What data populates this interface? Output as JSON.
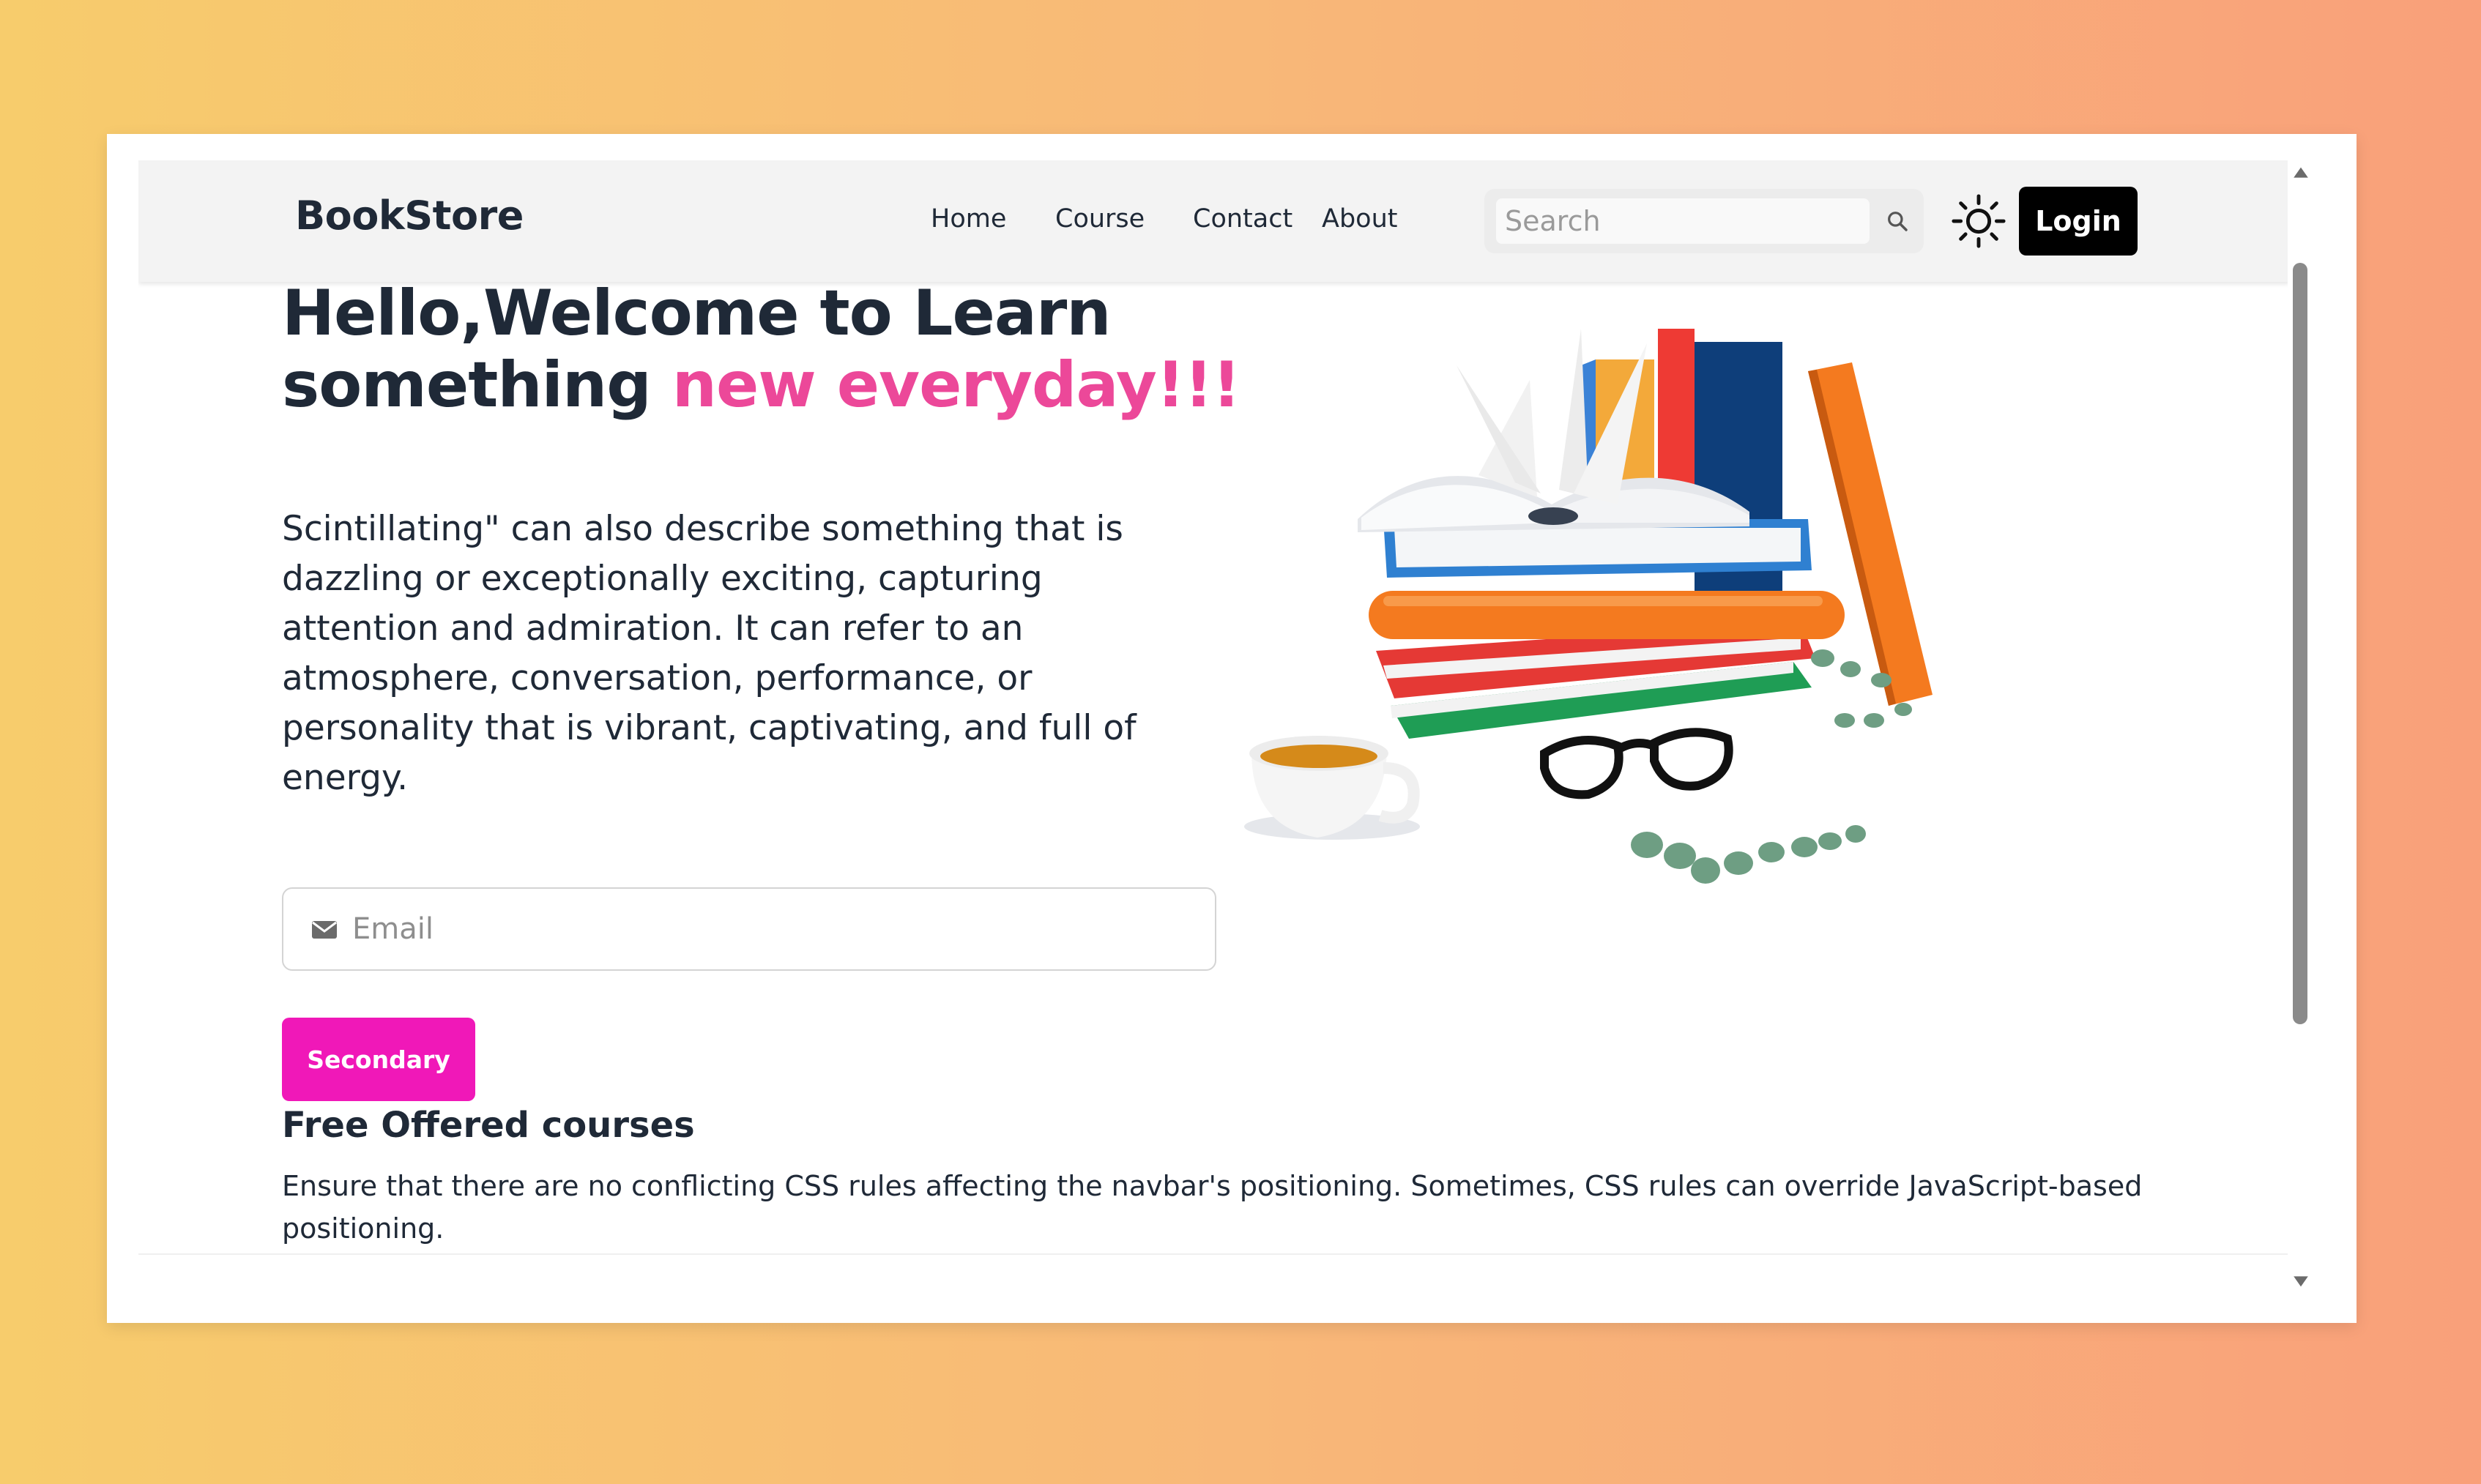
{
  "navbar": {
    "brand": "BookStore",
    "links": [
      "Home",
      "Course",
      "Contact",
      "About"
    ],
    "search_placeholder": "Search",
    "login_label": "Login"
  },
  "hero": {
    "title_part1": "Hello,Welcome to Learn",
    "title_part2": "something ",
    "title_accent": "new everyday!!!",
    "description": "Scintillating\" can also describe something that is dazzling or exceptionally exciting, capturing attention and admiration. It can refer to an atmosphere, conversation, performance, or personality that is vibrant, captivating, and full of energy.",
    "email_placeholder": "Email",
    "button_label": "Secondary"
  },
  "courses": {
    "title": "Free Offered courses",
    "text": "Ensure that there are no conflicting CSS rules affecting the navbar's positioning. Sometimes, CSS rules can override JavaScript-based positioning."
  },
  "icons": {
    "search": "search-icon",
    "theme": "sun-icon",
    "email": "mail-icon",
    "illustration": "books-illustration"
  },
  "colors": {
    "accent": "#ec4899",
    "secondary_button": "#f018b8",
    "login_button": "#000000",
    "text": "#1f2937"
  }
}
